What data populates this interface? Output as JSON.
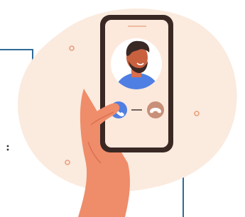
{
  "illustration": {
    "subject": "incoming-call",
    "colors": {
      "background": "#ffffff",
      "blob": "#fbeade",
      "accent_line": "#2f6a98",
      "phone_body": "#3a2824",
      "phone_screen": "#fde9dc",
      "avatar_circle": "#ffffff",
      "skin": "#ef8c6a",
      "skin_shadow": "#d96f4f",
      "hair": "#3a2824",
      "shirt": "#4f7fe3",
      "accept_button": "#4f7fe3",
      "decline_button": "#c89079",
      "sparkle": "#e7a07c"
    },
    "icons": {
      "accept": "phone-accept-icon",
      "decline": "phone-decline-icon"
    }
  }
}
